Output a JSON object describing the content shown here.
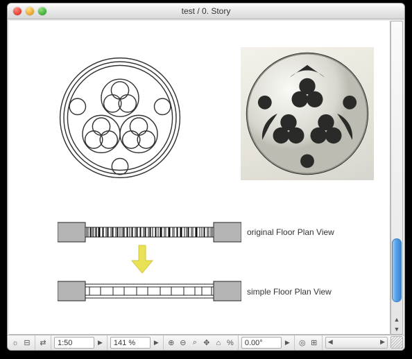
{
  "window": {
    "title": "test / 0. Story"
  },
  "labels": {
    "original": "original Floor Plan View",
    "simple": "simple Floor Plan View"
  },
  "toolbar": {
    "scale": "1:50",
    "zoom": "141 %",
    "angle": "0.00°"
  },
  "symbols": {
    "chevron_up": "▲",
    "chevron_down": "▼",
    "chevron_left": "◀",
    "chevron_right": "▶",
    "percent": "%",
    "swap": "⇄",
    "sun": "☼",
    "ruler": "⊟",
    "home": "⌂",
    "mag_plus": "⊕",
    "mag_minus": "⊖",
    "mag": "⌕",
    "hand": "✥",
    "target": "◎",
    "grid": "⊞"
  }
}
